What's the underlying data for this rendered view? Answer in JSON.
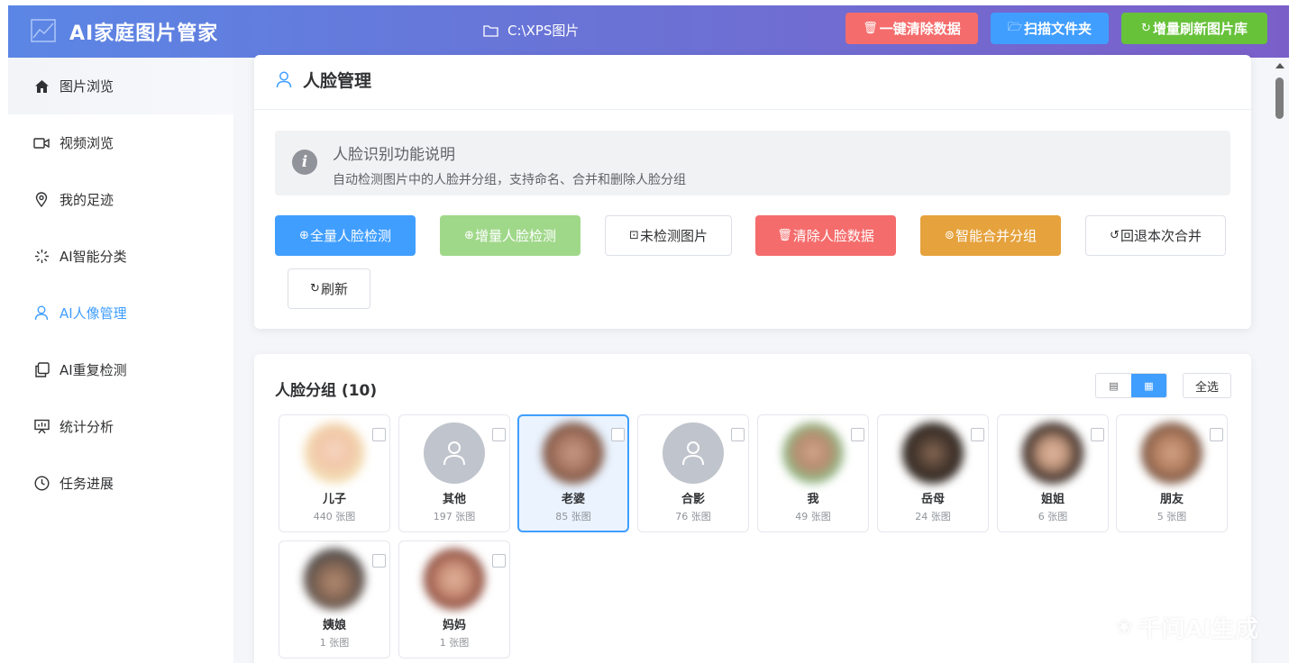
{
  "header": {
    "app_title": "AI家庭图片管家",
    "path": "C:\\XPS图片",
    "buttons": [
      {
        "label": "一键清除数据",
        "icon": "trash-icon",
        "color": "#f56c6c"
      },
      {
        "label": "扫描文件夹",
        "icon": "folder-open-icon",
        "color": "#409eff"
      },
      {
        "label": "增量刷新图片库",
        "icon": "refresh-icon",
        "color": "#67c23a"
      }
    ]
  },
  "sidebar": {
    "items": [
      {
        "label": "图片浏览",
        "icon": "home-icon"
      },
      {
        "label": "视频浏览",
        "icon": "video-camera-icon"
      },
      {
        "label": "我的足迹",
        "icon": "location-pin-icon"
      },
      {
        "label": "AI智能分类",
        "icon": "loading-spinner-icon"
      },
      {
        "label": "AI人像管理",
        "icon": "user-icon",
        "active": true
      },
      {
        "label": "AI重复检测",
        "icon": "copy-icon"
      },
      {
        "label": "统计分析",
        "icon": "data-board-icon"
      },
      {
        "label": "任务进展",
        "icon": "clock-icon"
      }
    ]
  },
  "face_panel": {
    "title": "人脸管理",
    "info_title": "人脸识别功能说明",
    "info_desc": "自动检测图片中的人脸并分组，支持命名、合并和删除人脸分组",
    "buttons": [
      {
        "label": "全量人脸检测",
        "icon": "circle-plus-icon"
      },
      {
        "label": "增量人脸检测",
        "icon": "circle-plus-icon"
      },
      {
        "label": "未检测图片",
        "icon": "picture-icon"
      },
      {
        "label": "清除人脸数据",
        "icon": "trash-icon"
      },
      {
        "label": "智能合并分组",
        "icon": "connection-icon"
      },
      {
        "label": "回退本次合并",
        "icon": "undo-icon"
      },
      {
        "label": "刷新",
        "icon": "refresh-icon"
      }
    ]
  },
  "groups": {
    "title": "人脸分组 (10)",
    "select_all": "全选",
    "items": [
      {
        "name": "儿子",
        "count": "440 张图"
      },
      {
        "name": "其他",
        "count": "197 张图"
      },
      {
        "name": "老婆",
        "count": "85 张图"
      },
      {
        "name": "合影",
        "count": "76 张图"
      },
      {
        "name": "我",
        "count": "49 张图"
      },
      {
        "name": "岳母",
        "count": "24 张图"
      },
      {
        "name": "姐姐",
        "count": "6 张图"
      },
      {
        "name": "朋友",
        "count": "5 张图"
      },
      {
        "name": "姨娘",
        "count": "1 张图"
      },
      {
        "name": "妈妈",
        "count": "1 张图"
      }
    ]
  },
  "watermark": "千问AI生成"
}
